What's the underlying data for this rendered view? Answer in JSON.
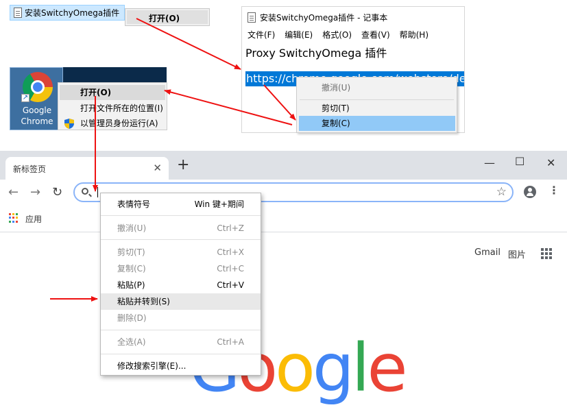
{
  "colors": {
    "accent": "#0078d7",
    "arrow": "#ee1111",
    "google_blue": "#4285f4",
    "google_red": "#ea4335",
    "google_yellow": "#fbbc05",
    "google_green": "#34a853"
  },
  "explorer": {
    "file_name": "安装SwitchyOmega插件",
    "open_label": "打开(O)"
  },
  "notepad": {
    "title": "安装SwitchyOmega插件 - 记事本",
    "menu": [
      "文件(F)",
      "编辑(E)",
      "格式(O)",
      "查看(V)",
      "帮助(H)"
    ],
    "line1": "Proxy SwitchyOmega 插件",
    "line2": "https://chrome.google.com/webstore/deta",
    "context_menu": {
      "undo": "撤消(U)",
      "cut": "剪切(T)",
      "copy": "复制(C)"
    }
  },
  "desktop": {
    "chrome_label_line1": "Google",
    "chrome_label_line2": "Chrome",
    "context_menu": {
      "open": "打开(O)",
      "open_location": "打开文件所在的位置(I)",
      "run_as_admin": "以管理员身份运行(A)"
    }
  },
  "browser": {
    "tab_title": "新标签页",
    "new_tab": "+",
    "bookmarks_apps": "应用",
    "gmail": "Gmail",
    "images": "图片",
    "google_letters": [
      "G",
      "o",
      "o",
      "g",
      "l",
      "e"
    ],
    "icons": [
      "close-icon",
      "minimize-icon",
      "maximize-icon",
      "back-icon",
      "forward-icon",
      "reload-icon",
      "search-icon",
      "star-icon",
      "avatar-icon",
      "more-icon",
      "apps-grid-icon"
    ],
    "context_menu": {
      "emoji": "表情符号",
      "emoji_sc": "Win 键+期间",
      "undo": "撤消(U)",
      "undo_sc": "Ctrl+Z",
      "cut": "剪切(T)",
      "cut_sc": "Ctrl+X",
      "copy": "复制(C)",
      "copy_sc": "Ctrl+C",
      "paste": "粘贴(P)",
      "paste_sc": "Ctrl+V",
      "paste_go": "粘贴并转到(S)",
      "delete": "删除(D)",
      "select_all": "全选(A)",
      "select_all_sc": "Ctrl+A",
      "edit_search": "修改搜索引擎(E)..."
    }
  }
}
